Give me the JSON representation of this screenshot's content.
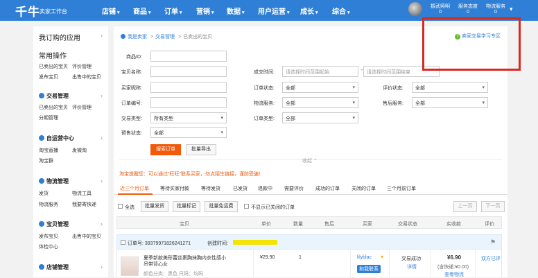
{
  "topbar": {
    "logo": "千牛",
    "subtitle": "卖家工作台",
    "nav": [
      "店铺",
      "商品",
      "订单",
      "营销",
      "数据",
      "用户运营",
      "成长",
      "综合"
    ],
    "utils": [
      {
        "label": "振武照明",
        "count": "0"
      },
      {
        "label": "服务态度",
        "count": "0"
      },
      {
        "label": "物流服务",
        "count": "0"
      }
    ],
    "more_icon": "caret-down-icon"
  },
  "sidebar": {
    "my_apps": "我订购的应用",
    "common_ops": "常用操作",
    "common_links": [
      "已卖出的宝贝",
      "评价管理",
      "发布宝贝",
      "出售中的宝贝"
    ],
    "sections": [
      {
        "title": "交易管理",
        "links": [
          "已卖出的宝贝",
          "评价管理",
          "分期管理"
        ]
      },
      {
        "title": "自运营中心",
        "links": [
          "淘宝直播",
          "发微淘",
          "淘宝群"
        ]
      },
      {
        "title": "物流管理",
        "links": [
          "发货",
          "物流工具",
          "物流服务",
          "我要寄快递"
        ]
      },
      {
        "title": "宝贝管理",
        "links": [
          "发布宝贝",
          "出售中的宝贝",
          "体检中心"
        ]
      },
      {
        "title": "店铺管理",
        "links": []
      }
    ]
  },
  "breadcrumb": {
    "home": "我是卖家",
    "sep": ">",
    "mid": "交易管理",
    "current": "已卖出的宝贝"
  },
  "learn_link": "卖家交易学习专区",
  "form": {
    "item_id": "商品ID:",
    "item_name": "宝贝名称:",
    "buyer_nick": "买家昵称:",
    "order_no": "订单编号:",
    "trade_type": "交易类型:",
    "trade_type_value": "所有类型",
    "presale": "预售状态:",
    "presale_value": "全部",
    "deal_time": "成交时间:",
    "time_start_ph": "请选择时间范围起始",
    "time_sep": "-",
    "time_end_ph": "请选择时间范围结束",
    "order_status": "订单状态:",
    "order_status_value": "全部",
    "rate_status": "评价状态:",
    "rate_status_value": "全部",
    "logistics": "物流服务:",
    "logistics_value": "全部",
    "after_sale": "售后服务:",
    "after_sale_value": "全部",
    "order_type": "订单类型:",
    "order_type_value": "全部",
    "search_btn": "搜索订单",
    "export_btn": "批量导出",
    "collapse": "收起"
  },
  "notice": "淘宝提醒您：可以通过\"旺旺\"联系买家，勿点陌生链接，谨防受骗！",
  "tabs": [
    "近三个月订单",
    "等待买家付款",
    "等待发货",
    "已发货",
    "退款中",
    "需要评价",
    "成功的订单",
    "关闭的订单",
    "三个月前订单"
  ],
  "toolbar": {
    "select_all": "全选",
    "batch_ship": "批量发货",
    "batch_mark": "批量标记",
    "batch_free": "批量免运费",
    "hide_closed": "不显示已关闭的订单",
    "prev": "上一页",
    "next": "下一页"
  },
  "table_headers": [
    "宝贝",
    "单价",
    "数量",
    "售后",
    "买家",
    "交易状态",
    "实收款",
    "评价"
  ],
  "order": {
    "order_no": "订单号: 39379971826241271",
    "create_time": "创建时间:",
    "title": "夏季新款美形蕾丝裹胸抹胸内衣性感小吊带背心女",
    "specs": "颜色分类：黑色 尺码：均码",
    "price": "¥29.90",
    "qty": "1",
    "buyer": "lilyblac",
    "buyer_tag": "和我联系",
    "status": "交易成功",
    "status_link": "详情",
    "paid": "¥6.90",
    "freight": "(含快递:¥0.00)",
    "logistics_link": "查看物流",
    "rate": "双方已评"
  }
}
